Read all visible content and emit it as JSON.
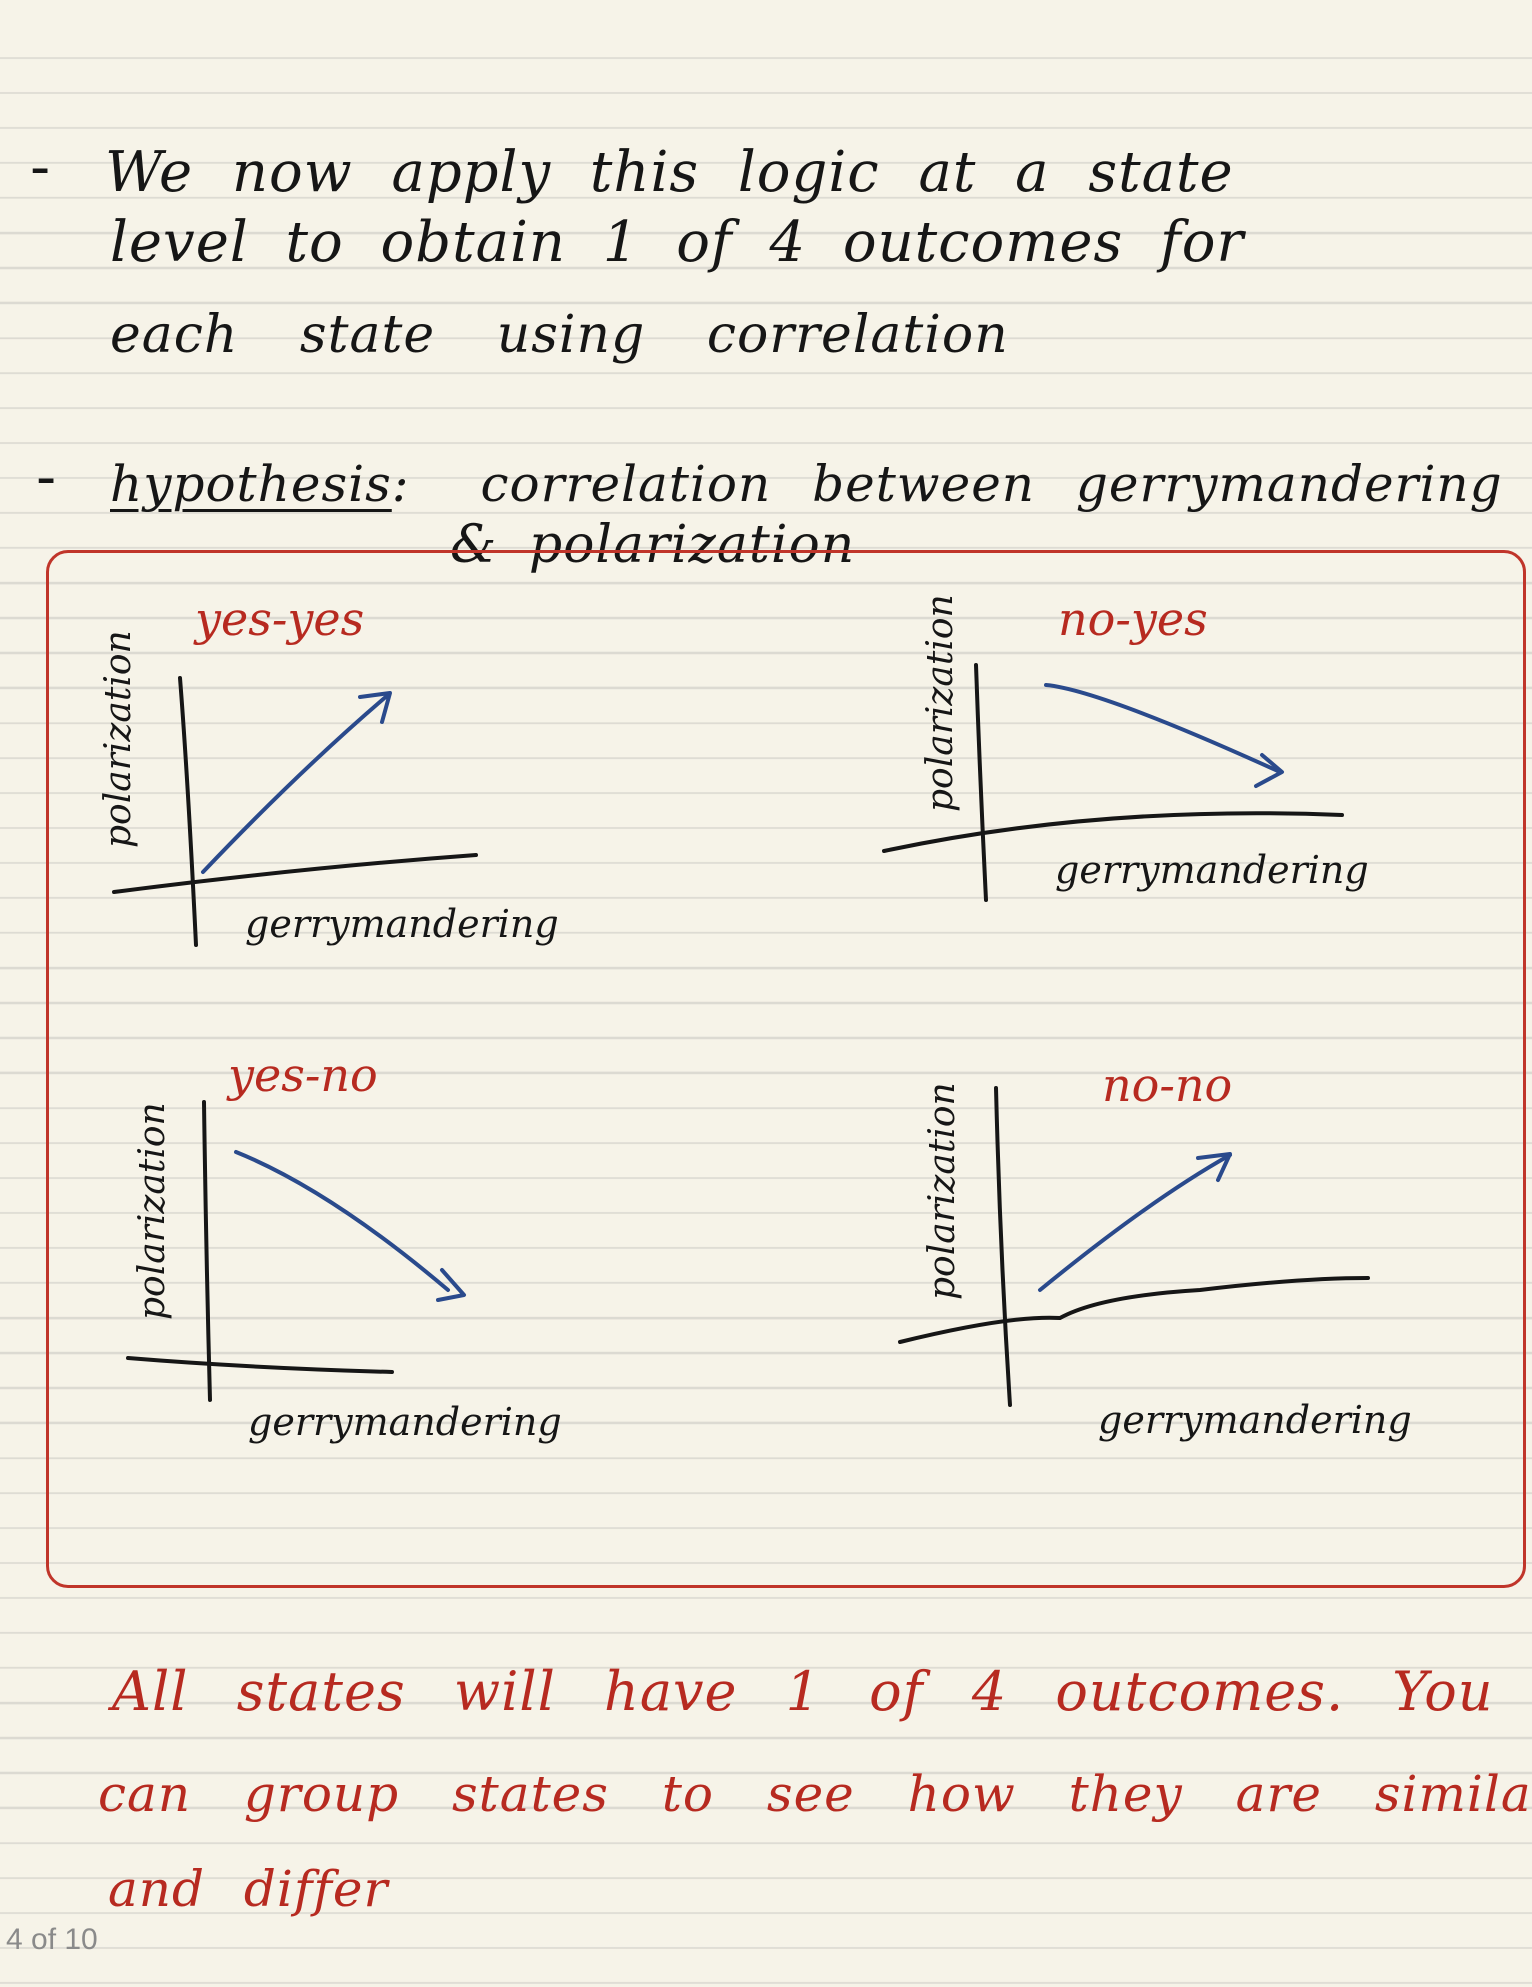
{
  "notes": {
    "bullet_1": {
      "marker": "-",
      "line_1": "We now apply this logic at a state",
      "line_2": "level to obtain 1 of 4 outcomes for",
      "line_3": "each state using correlation"
    },
    "bullet_2": {
      "marker": "-",
      "label": "hypothesis",
      "separator": ":",
      "line_1_rest": "correlation between gerrymandering",
      "line_2": "& polarization"
    }
  },
  "graphs": [
    {
      "id": "yes-yes",
      "outcome_label": "yes-yes",
      "x_axis_label": "gerrymandering",
      "y_axis_label": "polarization",
      "trend": "increasing"
    },
    {
      "id": "no-yes",
      "outcome_label": "no-yes",
      "x_axis_label": "gerrymandering",
      "y_axis_label": "polarization",
      "trend": "decreasing"
    },
    {
      "id": "yes-no",
      "outcome_label": "yes-no",
      "x_axis_label": "gerrymandering",
      "y_axis_label": "polarization",
      "trend": "decreasing"
    },
    {
      "id": "no-no",
      "outcome_label": "no-no",
      "x_axis_label": "gerrymandering",
      "y_axis_label": "polarization",
      "trend": "increasing"
    }
  ],
  "conclusion": {
    "line_1": "All states will have 1 of 4 outcomes. You",
    "line_2": "can group states to see how they are similar",
    "line_3": "and differ"
  },
  "page_indicator": "4 of 10",
  "colors": {
    "paper": "#f6f3e8",
    "rule_line": "#dcdad2",
    "ink_black": "#161616",
    "ink_red": "#b72a20",
    "ink_blue": "#2a4a8c",
    "frame_red": "#c0352a"
  }
}
